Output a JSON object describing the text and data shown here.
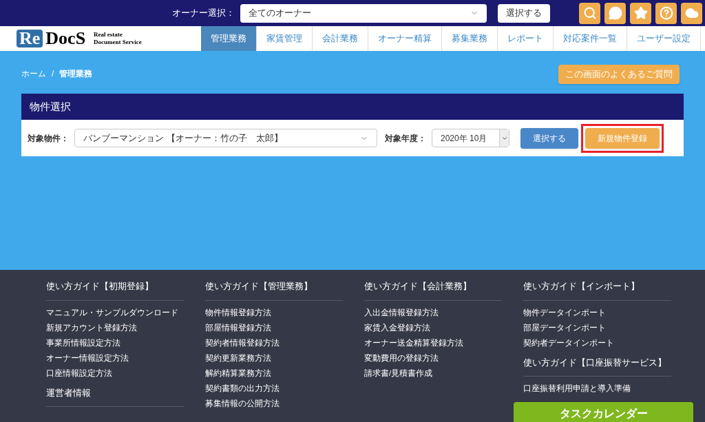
{
  "top_bar": {
    "owner_label": "オーナー選択：",
    "owner_select": "全てのオーナー",
    "select_button": "選択する"
  },
  "logo": {
    "mark": "Re",
    "word": "DocS",
    "tagline_1": "Real estate",
    "tagline_2": "Document Service"
  },
  "nav": [
    {
      "label": "管理業務",
      "selected": true
    },
    {
      "label": "家賃管理",
      "selected": false
    },
    {
      "label": "会計業務",
      "selected": false
    },
    {
      "label": "オーナー精算",
      "selected": false
    },
    {
      "label": "募集業務",
      "selected": false
    },
    {
      "label": "レポート",
      "selected": false
    },
    {
      "label": "対応案件一覧",
      "selected": false
    },
    {
      "label": "ユーザー設定",
      "selected": false
    }
  ],
  "breadcrumb": {
    "home": "ホーム",
    "separator": "/",
    "current": "管理業務"
  },
  "faq_button": "この画面のよくあるご質問",
  "panel": {
    "title": "物件選択",
    "property_label": "対象物件：",
    "property_value": "バンブーマンション 【オーナー：竹の子　太郎】",
    "year_label": "対象年度：",
    "year_value": "2020年 10月",
    "select_button": "選択する",
    "new_button": {
      "label": "新規物件登録",
      "highlighted": true
    }
  },
  "footer": {
    "columns": [
      {
        "sections": [
          {
            "title": "使い方ガイド【初期登録】",
            "links": [
              "マニュアル・サンプルダウンロード",
              "新規アカウント登録方法",
              "事業所情報設定方法",
              "オーナー情報設定方法",
              "口座情報設定方法"
            ]
          },
          {
            "title": "運営者情報"
          }
        ]
      },
      {
        "sections": [
          {
            "title": "使い方ガイド【管理業務】",
            "links": [
              "物件情報登録方法",
              "部屋情報登録方法",
              "契約者情報登録方法",
              "契約更新業務方法",
              "解約精算業務方法",
              "契約書類の出力方法",
              "募集情報の公開方法"
            ]
          }
        ]
      },
      {
        "sections": [
          {
            "title": "使い方ガイド【会計業務】",
            "links": [
              "入出金情報登録方法",
              "家賃入金登録方法",
              "オーナー送金精算登録方法",
              "変動費用の登録方法",
              "請求書/見積書作成"
            ]
          }
        ]
      },
      {
        "sections": [
          {
            "title": "使い方ガイド【インポート】",
            "links": [
              "物件データインポート",
              "部屋データインポート",
              "契約者データインポート"
            ]
          },
          {
            "title": "使い方ガイド【口座振替サービス】",
            "links": [
              "口座振替利用申請と導入準備"
            ]
          }
        ]
      }
    ],
    "task_button": "タスクカレンダー"
  }
}
